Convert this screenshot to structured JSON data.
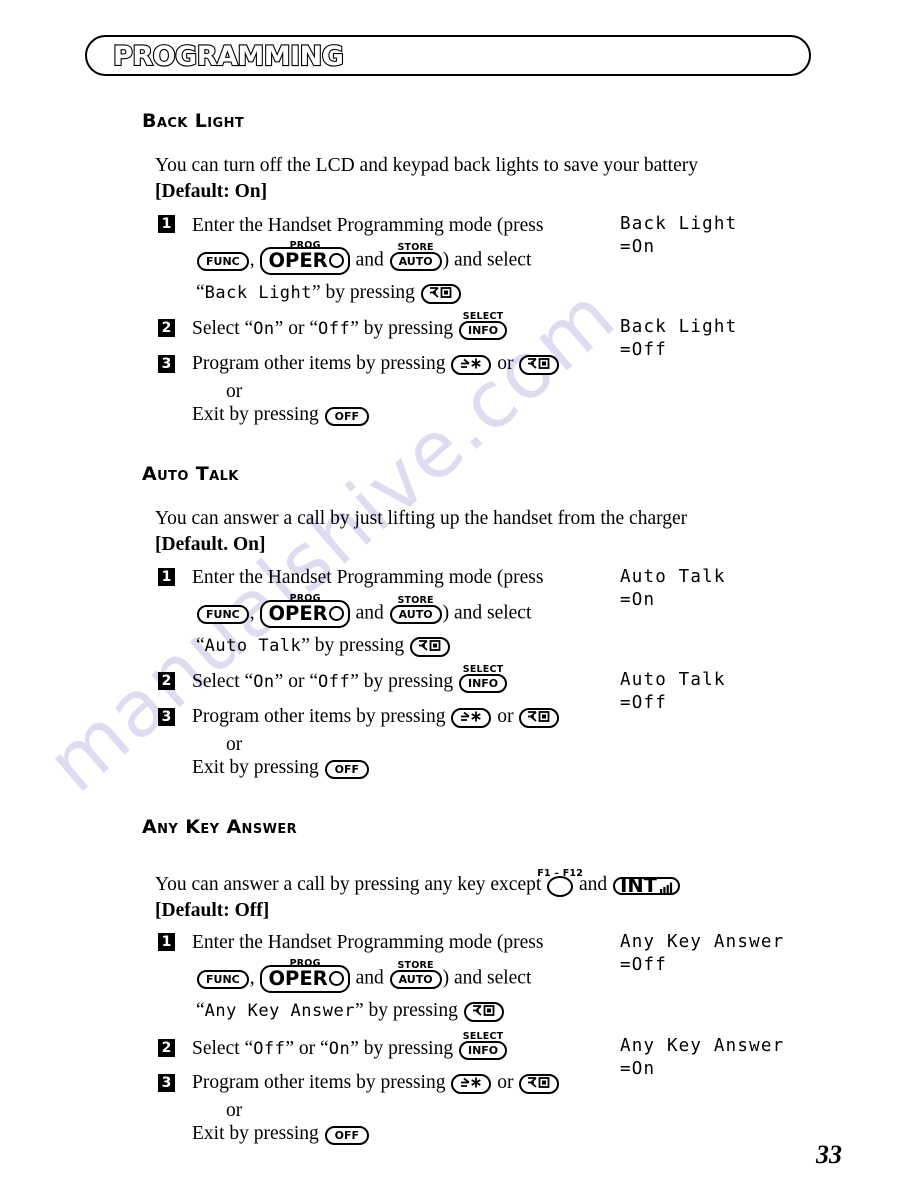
{
  "page": {
    "banner_title": "PROGRAMMING",
    "page_number": "33",
    "watermark": "manualshive.com"
  },
  "keys": {
    "func": "FUNC",
    "oper": "OPER",
    "oper_sup": "PROG",
    "auto": "AUTO",
    "auto_sup": "STORE",
    "info": "INFO",
    "info_sup": "SELECT",
    "off": "OFF",
    "int": "INT",
    "f_range": "F1 – F12",
    "down_box_icon": "down-arrow-box-key",
    "up_star_icon": "up-arrow-star-key",
    "f1f12_icon": "f1-f12-oval-key",
    "int_icon": "int-signal-key"
  },
  "sections": [
    {
      "heading_cap": "B",
      "heading_rest": "ACK ",
      "heading_cap2": "L",
      "heading_rest2": "IGHT",
      "heading_plain": "Back Light",
      "intro_line1": "You can turn off the LCD and keypad back lights to save your battery",
      "intro_line2": "[Default: On]",
      "steps": [
        {
          "num": "1",
          "line1_a": "Enter the Handset Programming mode (press",
          "line2_a": ",",
          "line2_b": "and",
          "line2_c": ") and select",
          "line3_a": "“",
          "line3_lcd": "Back Light",
          "line3_b": "” by pressing"
        },
        {
          "num": "2",
          "line1_a": "Select “",
          "line1_lcd1": "On",
          "line1_b": "” or “",
          "line1_lcd2": "Off",
          "line1_c": "” by pressing"
        },
        {
          "num": "3",
          "line1_a": "Program other items by pressing",
          "line1_b": "or",
          "line2": "or",
          "line3": "Exit by pressing"
        }
      ],
      "lcd_top": "Back Light\n=On",
      "lcd_bottom": "Back Light\n=Off"
    },
    {
      "heading_plain": "Auto Talk",
      "intro_line1": "You can answer a call by just lifting up the handset from the charger",
      "intro_line2": "[Default. On]",
      "steps": [
        {
          "num": "1",
          "line1_a": "Enter the Handset Programming mode (press",
          "line2_a": ",",
          "line2_b": "and",
          "line2_c": ") and select",
          "line3_a": "“",
          "line3_lcd": "Auto Talk",
          "line3_b": "” by pressing"
        },
        {
          "num": "2",
          "line1_a": "Select “",
          "line1_lcd1": "On",
          "line1_b": "” or “",
          "line1_lcd2": "Off",
          "line1_c": "” by pressing"
        },
        {
          "num": "3",
          "line1_a": "Program other items by pressing",
          "line1_b": "or",
          "line2": "or",
          "line3": "Exit by pressing"
        }
      ],
      "lcd_top": "Auto Talk\n=On",
      "lcd_bottom": "Auto Talk\n=Off"
    },
    {
      "heading_plain": "Any Key Answer",
      "intro_a": "You can answer a call by pressing any key except",
      "intro_b": "and",
      "intro_line2": "[Default: Off]",
      "steps": [
        {
          "num": "1",
          "line1_a": "Enter the Handset Programming mode (press",
          "line2_a": ",",
          "line2_b": "and",
          "line2_c": ") and select",
          "line3_a": "“",
          "line3_lcd": "Any Key Answer",
          "line3_b": "” by pressing"
        },
        {
          "num": "2",
          "line1_a": "Select “",
          "line1_lcd1": "Off",
          "line1_b": "” or “",
          "line1_lcd2": "On",
          "line1_c": "” by pressing"
        },
        {
          "num": "3",
          "line1_a": "Program other items by pressing",
          "line1_b": "or",
          "line2": "or",
          "line3": "Exit by pressing"
        }
      ],
      "lcd_top": "Any Key Answer\n=Off",
      "lcd_bottom": "Any Key Answer\n=On"
    }
  ]
}
